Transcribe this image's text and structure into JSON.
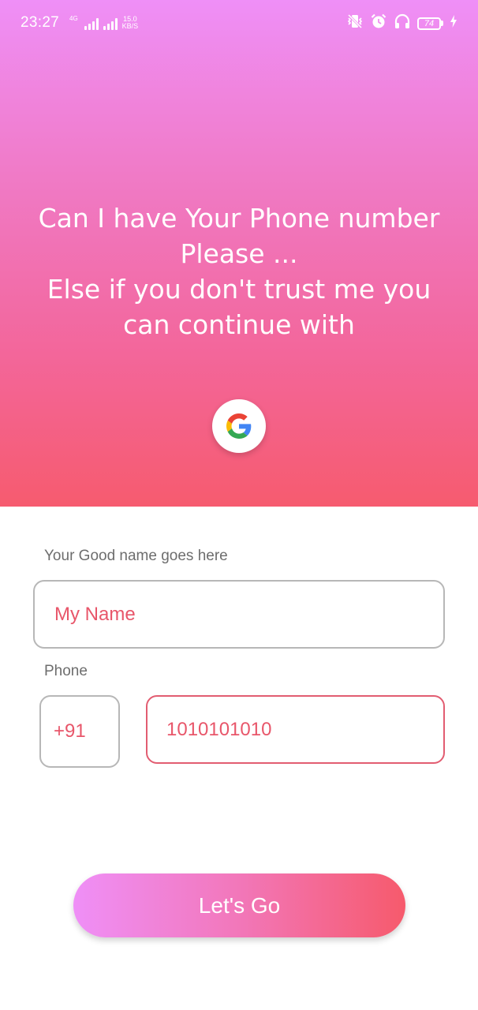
{
  "status_bar": {
    "time": "23:27",
    "network_type": "4G",
    "speed_value": "15.0",
    "speed_unit": "KB/S",
    "battery": "74",
    "icons": [
      "vibrate-icon",
      "alarm-icon",
      "headphones-icon",
      "battery-icon",
      "charging-icon"
    ]
  },
  "hero": {
    "lines": [
      "Can I have Your Phone number",
      "Please ...",
      "Else if you don't trust me you",
      "can continue with"
    ],
    "google_icon": "google-icon"
  },
  "form": {
    "name_label": "Your Good name goes here",
    "name_value": "My Name",
    "phone_label": "Phone",
    "country_code": "+91",
    "phone_value": "1010101010"
  },
  "submit": {
    "label": "Let's Go"
  },
  "colors": {
    "gradient_start": "#ef8ff7",
    "gradient_end": "#f65a6c",
    "accent_text": "#e8566a",
    "phone_border": "#e25d71"
  }
}
